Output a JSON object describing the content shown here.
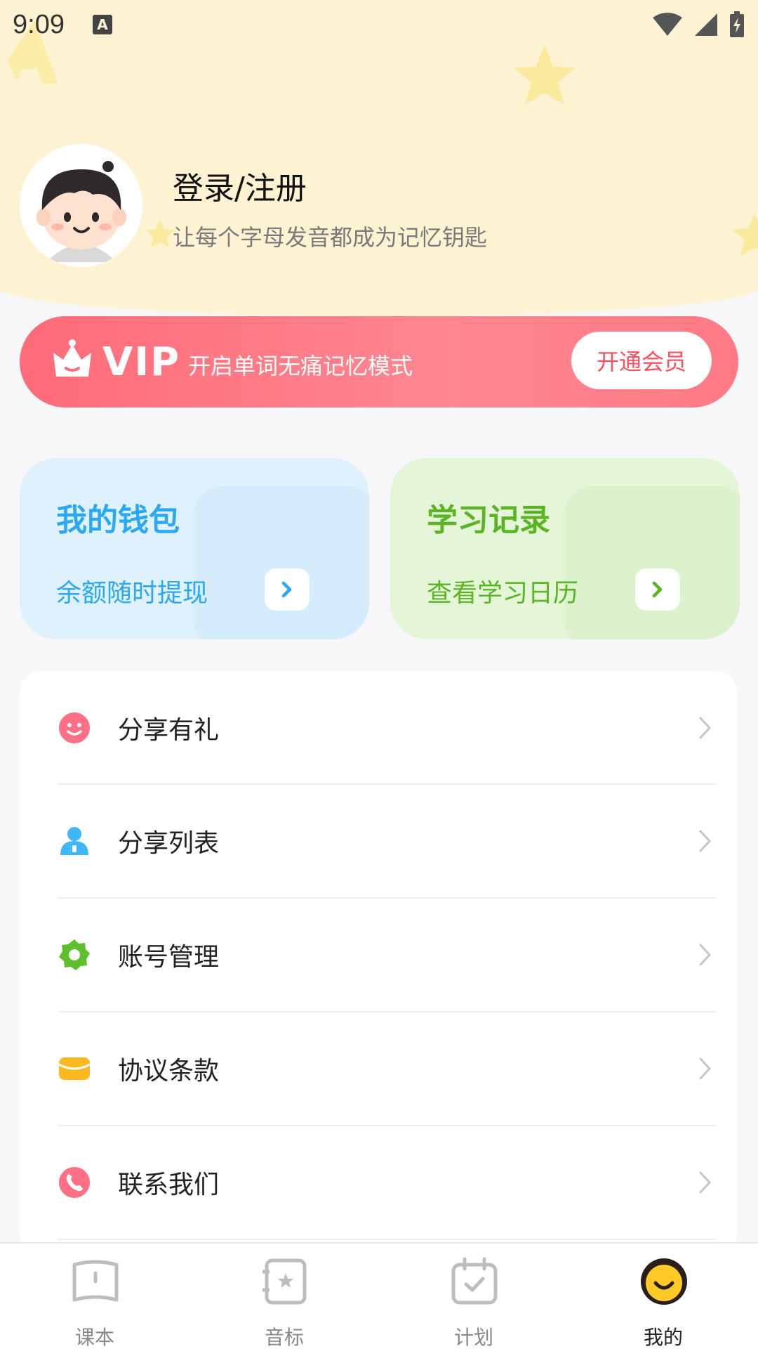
{
  "status_bar": {
    "time": "9:09",
    "notification_icon_letter": "A"
  },
  "profile": {
    "title": "登录/注册",
    "subtitle": "让每个字母发音都成为记忆钥匙"
  },
  "vip": {
    "label": "VIP",
    "description": "开启单词无痛记忆模式",
    "button": "开通会员"
  },
  "cards": {
    "wallet": {
      "title": "我的钱包",
      "subtitle": "余额随时提现"
    },
    "study": {
      "title": "学习记录",
      "subtitle": "查看学习日历"
    }
  },
  "menu": {
    "items": [
      {
        "label": "分享有礼",
        "icon": "smile-icon",
        "color": "#ff6f86"
      },
      {
        "label": "分享列表",
        "icon": "person-icon",
        "color": "#3fb6f6"
      },
      {
        "label": "账号管理",
        "icon": "gear-icon",
        "color": "#5dbf2c"
      },
      {
        "label": "协议条款",
        "icon": "card-icon",
        "color": "#ffb81f"
      },
      {
        "label": "联系我们",
        "icon": "phone-icon",
        "color": "#ff6f86"
      }
    ]
  },
  "nav": {
    "items": [
      {
        "label": "课本",
        "icon": "book-icon"
      },
      {
        "label": "音标",
        "icon": "phonetic-icon"
      },
      {
        "label": "计划",
        "icon": "calendar-icon"
      },
      {
        "label": "我的",
        "icon": "profile-smile-icon",
        "active": true
      }
    ]
  },
  "colors": {
    "header_bg": "#fdf3d3",
    "vip_red": "#ff6b78",
    "wallet_blue": "#2ba8f3",
    "study_green": "#5bb424"
  }
}
